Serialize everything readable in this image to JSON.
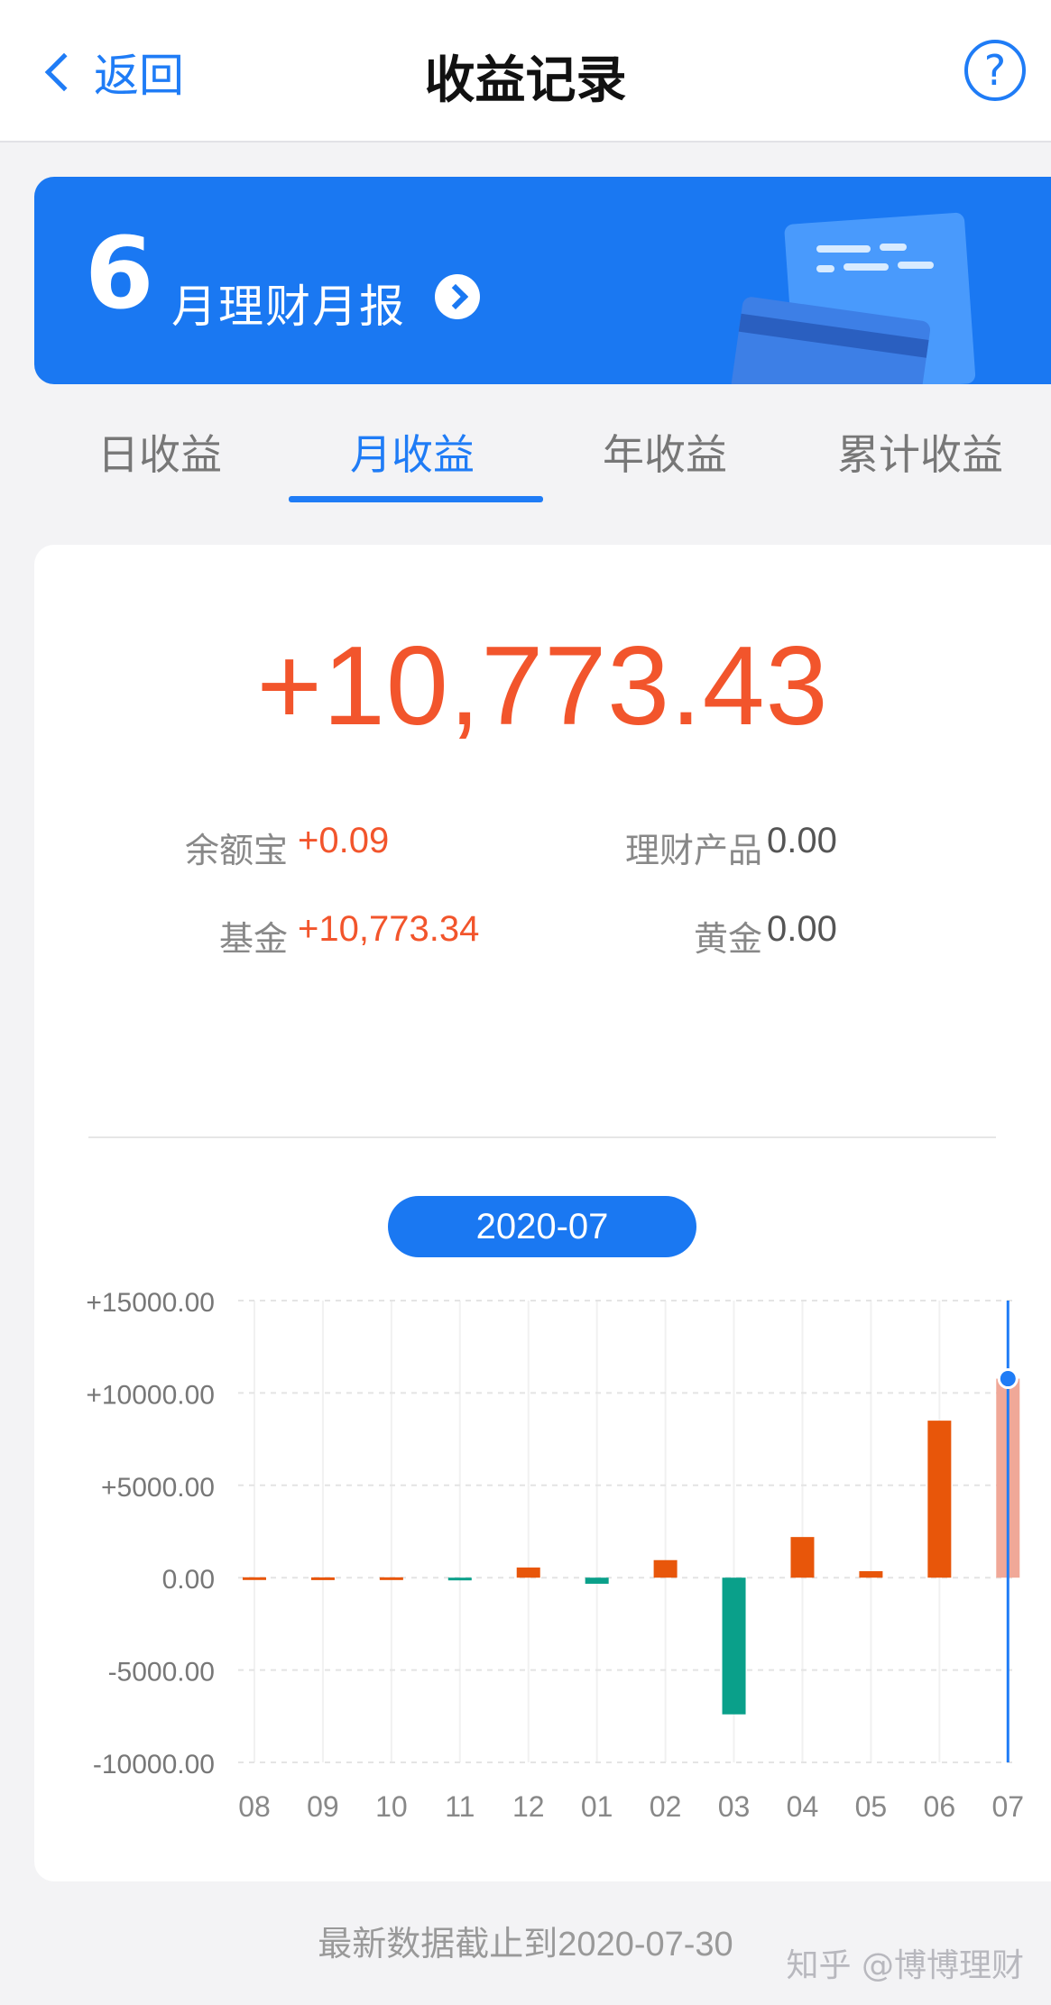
{
  "header": {
    "back_label": "返回",
    "title": "收益记录",
    "help_symbol": "?"
  },
  "banner": {
    "month": "6",
    "text": "月理财月报"
  },
  "tabs": [
    {
      "label": "日收益",
      "active": false
    },
    {
      "label": "月收益",
      "active": true
    },
    {
      "label": "年收益",
      "active": false
    },
    {
      "label": "累计收益",
      "active": false
    }
  ],
  "summary": {
    "total": "+10,773.43",
    "breakdown": [
      {
        "label": "余额宝",
        "value": "+0.09"
      },
      {
        "label": "理财产品",
        "value": "0.00"
      },
      {
        "label": "基金",
        "value": "+10,773.34"
      },
      {
        "label": "黄金",
        "value": "0.00"
      }
    ]
  },
  "selected_period": "2020-07",
  "chart_data": {
    "type": "bar",
    "categories": [
      "08",
      "09",
      "10",
      "11",
      "12",
      "01",
      "02",
      "03",
      "04",
      "05",
      "06",
      "07"
    ],
    "values": [
      20,
      15,
      18,
      -120,
      550,
      -330,
      950,
      -7400,
      2200,
      350,
      8500,
      10773.43
    ],
    "ylim": [
      -10000,
      15000
    ],
    "yticks": [
      15000,
      10000,
      5000,
      0,
      -5000,
      -10000
    ],
    "ytick_labels": [
      "+15000.00",
      "+10000.00",
      "+5000.00",
      "0.00",
      "-5000.00",
      "-10000.00"
    ],
    "selected_category": "07",
    "grid": true,
    "colors": {
      "positive": "#e8560a",
      "negative": "#0aa08a",
      "selected": "#f0a898",
      "cursor": "#1f7cf6"
    }
  },
  "footer_note": "最新数据截止到2020-07-30",
  "watermark": "知乎 @博博理财"
}
